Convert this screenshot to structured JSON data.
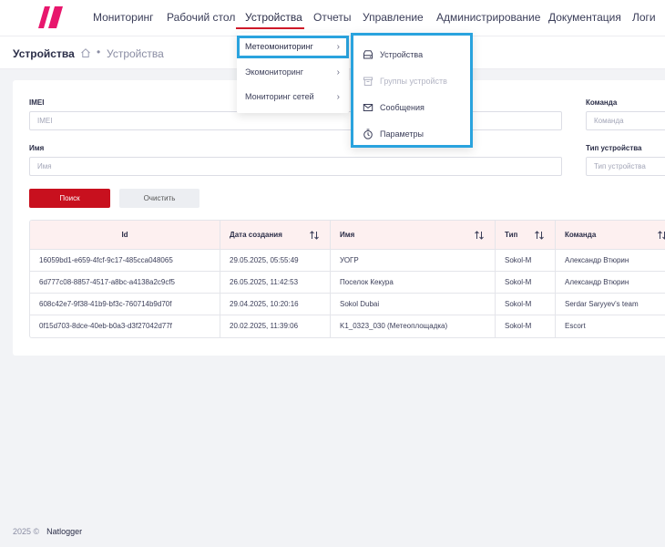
{
  "nav": {
    "items": [
      "Мониторинг",
      "Рабочий стол",
      "Устройства",
      "Отчеты",
      "Управление",
      "Администрирование",
      "Документация",
      "Логи"
    ],
    "active": "Устройства",
    "accent_color": "#d01a2a"
  },
  "breadcrumb": {
    "title": "Устройства",
    "home_icon": "home-icon",
    "separator": "•",
    "current": "Устройства"
  },
  "filters": {
    "imei": {
      "label": "IMEI",
      "placeholder": "IMEI"
    },
    "name": {
      "label": "Имя",
      "placeholder": "Имя"
    },
    "team": {
      "label": "Команда",
      "placeholder": "Команда"
    },
    "type": {
      "label": "Тип устройства",
      "placeholder": "Тип устройства"
    },
    "search_label": "Поиск",
    "clear_label": "Очистить",
    "search_color": "#c8101e"
  },
  "table": {
    "columns": [
      "Id",
      "Дата создания",
      "Имя",
      "Тип",
      "Команда"
    ],
    "rows": [
      [
        "16059bd1-e659-4fcf-9c17-485cca048065",
        "29.05.2025, 05:55:49",
        "УОГР",
        "Sokol-M",
        "Александр Втюрин"
      ],
      [
        "6d777c08-8857-4517-a8bc-a4138a2c9cf5",
        "26.05.2025, 11:42:53",
        "Поселок Кекура",
        "Sokol-M",
        "Александр Втюрин"
      ],
      [
        "608c42e7-9f38-41b9-bf3c-760714b9d70f",
        "29.04.2025, 10:20:16",
        "Sokol Dubai",
        "Sokol-M",
        "Serdar Saryyev's team"
      ],
      [
        "0f15d703-8dce-40eb-b0a3-d3f27042d77f",
        "20.02.2025, 11:39:06",
        "K1_0323_030 (Метеоплощадка)",
        "Sokol-M",
        "Escort"
      ]
    ]
  },
  "submenu_devices": {
    "items": [
      {
        "label": "Метеомониторинг",
        "highlighted": true
      },
      {
        "label": "Экомониторинг",
        "highlighted": false
      },
      {
        "label": "Мониторинг сетей",
        "highlighted": false
      }
    ],
    "highlight_color": "#2aa3de"
  },
  "submenu_meteo": {
    "items": [
      {
        "label": "Устройства",
        "icon": "device-icon",
        "disabled": false
      },
      {
        "label": "Группы устройств",
        "icon": "box-icon",
        "disabled": true
      },
      {
        "label": "Сообщения",
        "icon": "mail-icon",
        "disabled": false
      },
      {
        "label": "Параметры",
        "icon": "stopwatch-icon",
        "disabled": false
      }
    ]
  },
  "footer": {
    "year": "2025 ©",
    "brand": "Natlogger"
  }
}
